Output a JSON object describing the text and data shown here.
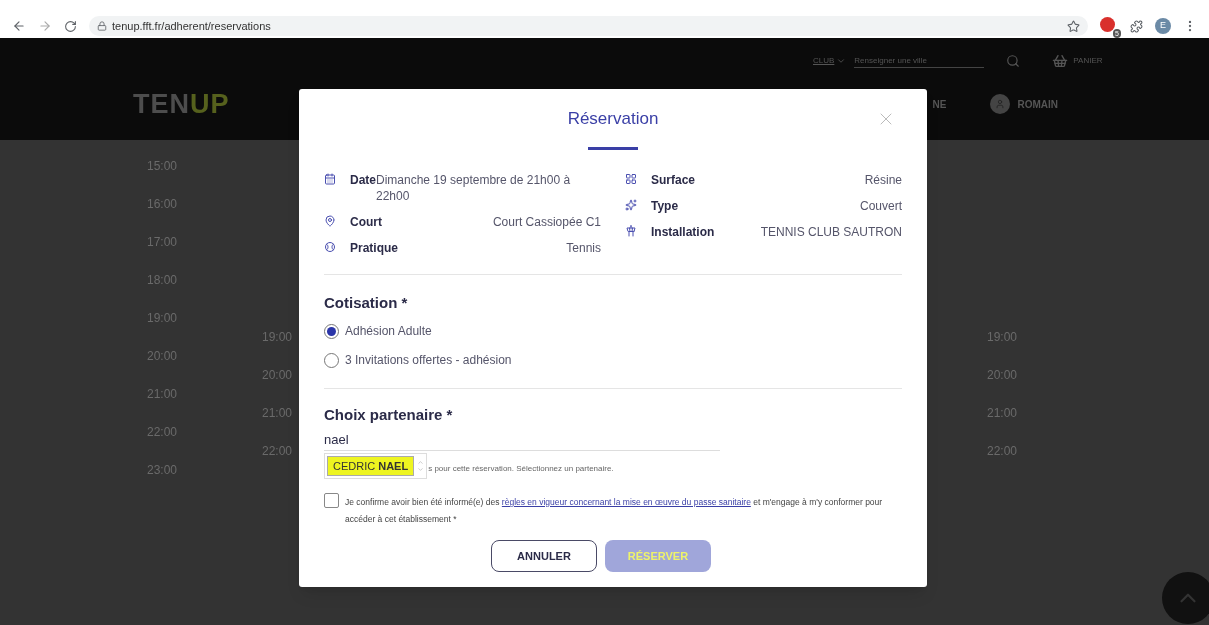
{
  "browser": {
    "url": "tenup.fft.fr/adherent/reservations",
    "extension_badge": "5",
    "profile_initial": "E"
  },
  "header": {
    "club_label": "CLUB",
    "city_search": {
      "placeholder": "Renseigner une ville"
    },
    "cart_label": "PANIER",
    "logo": {
      "part_1": "TEN",
      "part_2": "UP"
    },
    "nav_fragment": "NE",
    "user_name": "ROMAIN"
  },
  "schedule": {
    "columns": [
      {
        "times": [
          "15:00",
          "16:00",
          "17:00",
          "18:00",
          "19:00",
          "20:00",
          "21:00",
          "22:00",
          "23:00"
        ]
      },
      {
        "times": [
          "19:00",
          "20:00",
          "21:00",
          "22:00"
        ]
      },
      {
        "times": [
          "19:00",
          "20:00",
          "21:00",
          "22:00"
        ]
      }
    ]
  },
  "modal": {
    "title": "Réservation",
    "details_left": [
      {
        "label": "Date",
        "value": "Dimanche 19 septembre de 21h00 à 22h00"
      },
      {
        "label": "Court",
        "value": "Court Cassiopée C1"
      },
      {
        "label": "Pratique",
        "value": "Tennis"
      }
    ],
    "details_right": [
      {
        "label": "Surface",
        "value": "Résine"
      },
      {
        "label": "Type",
        "value": "Couvert"
      },
      {
        "label": "Installation",
        "value": "TENNIS CLUB SAUTRON"
      }
    ],
    "cotisation": {
      "heading": "Cotisation *",
      "options": [
        {
          "label": "Adhésion Adulte",
          "selected": true
        },
        {
          "label": "3 Invitations offertes - adhésion",
          "selected": false
        }
      ]
    },
    "partner": {
      "heading": "Choix partenaire *",
      "value": "nael",
      "suggestion": "CEDRIC **NAEL**",
      "hint": "s pour cette réservation. Sélectionnez un partenaire."
    },
    "consent": {
      "checked": false,
      "before": "Je confirme avoir bien été informé(e) des ",
      "link": "règles en vigueur concernant la mise en œuvre du passe sanitaire",
      "after": " et m'engage à m'y conformer pour accéder à cet établissement  *"
    },
    "buttons": [
      {
        "label": "ANNULER",
        "kind": "outline"
      },
      {
        "label": "RÉSERVER",
        "kind": "primary",
        "disabled": true
      }
    ]
  }
}
